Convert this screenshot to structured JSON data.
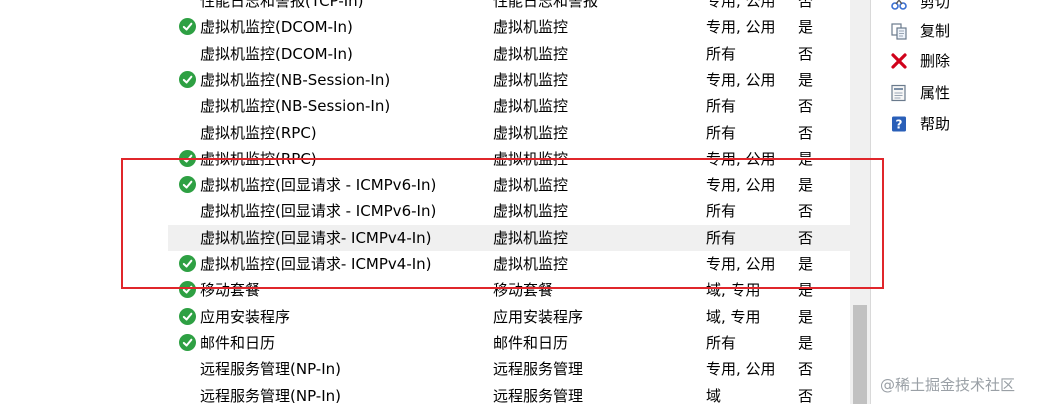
{
  "rules": [
    {
      "name": "性能日志和警报(TCP-In)",
      "group": "性能日志和警报",
      "profile": "专用, 公用",
      "enabled": "否",
      "icon": false
    },
    {
      "name": "虚拟机监控(DCOM-In)",
      "group": "虚拟机监控",
      "profile": "专用, 公用",
      "enabled": "是",
      "icon": true
    },
    {
      "name": "虚拟机监控(DCOM-In)",
      "group": "虚拟机监控",
      "profile": "所有",
      "enabled": "否",
      "icon": false
    },
    {
      "name": "虚拟机监控(NB-Session-In)",
      "group": "虚拟机监控",
      "profile": "专用, 公用",
      "enabled": "是",
      "icon": true
    },
    {
      "name": "虚拟机监控(NB-Session-In)",
      "group": "虚拟机监控",
      "profile": "所有",
      "enabled": "否",
      "icon": false
    },
    {
      "name": "虚拟机监控(RPC)",
      "group": "虚拟机监控",
      "profile": "所有",
      "enabled": "否",
      "icon": false
    },
    {
      "name": "虚拟机监控(RPC)",
      "group": "虚拟机监控",
      "profile": "专用, 公用",
      "enabled": "是",
      "icon": true
    },
    {
      "name": "虚拟机监控(回显请求 - ICMPv6-In)",
      "group": "虚拟机监控",
      "profile": "专用, 公用",
      "enabled": "是",
      "icon": true
    },
    {
      "name": "虚拟机监控(回显请求 - ICMPv6-In)",
      "group": "虚拟机监控",
      "profile": "所有",
      "enabled": "否",
      "icon": false
    },
    {
      "name": "虚拟机监控(回显请求- ICMPv4-In)",
      "group": "虚拟机监控",
      "profile": "所有",
      "enabled": "否",
      "icon": false,
      "highlight": true
    },
    {
      "name": "虚拟机监控(回显请求- ICMPv4-In)",
      "group": "虚拟机监控",
      "profile": "专用, 公用",
      "enabled": "是",
      "icon": true
    },
    {
      "name": "移动套餐",
      "group": "移动套餐",
      "profile": "域, 专用",
      "enabled": "是",
      "icon": true
    },
    {
      "name": "应用安装程序",
      "group": "应用安装程序",
      "profile": "域, 专用",
      "enabled": "是",
      "icon": true
    },
    {
      "name": "邮件和日历",
      "group": "邮件和日历",
      "profile": "所有",
      "enabled": "是",
      "icon": true
    },
    {
      "name": "远程服务管理(NP-In)",
      "group": "远程服务管理",
      "profile": "专用, 公用",
      "enabled": "否",
      "icon": false
    },
    {
      "name": "远程服务管理(NP-In)",
      "group": "远程服务管理",
      "profile": "域",
      "enabled": "否",
      "icon": false
    }
  ],
  "actions": [
    {
      "label": "剪切",
      "icon": "scissors-icon"
    },
    {
      "label": "复制",
      "icon": "copy-icon"
    },
    {
      "label": "删除",
      "icon": "delete-x-icon"
    },
    {
      "label": "属性",
      "icon": "properties-icon"
    },
    {
      "label": "帮助",
      "icon": "help-icon"
    }
  ],
  "watermark": "@稀土掘金技术社区",
  "colors": {
    "check": "#2ea043",
    "delete": "#d0021b",
    "highlight_box": "#e0262b",
    "help": "#2a5fb8"
  }
}
